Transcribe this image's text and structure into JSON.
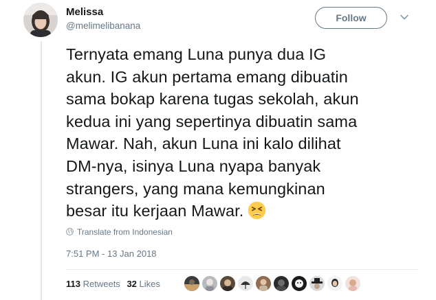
{
  "author": {
    "display_name": "Melissa",
    "handle": "@melimelibanana",
    "avatar_icon": "user-avatar"
  },
  "follow_label": "Follow",
  "tweet": {
    "lines": [
      "Ternyata emang Luna punya dua IG",
      "akun. IG akun pertama emang dibuatin",
      "sama bokap karena tugas sekolah, akun",
      "kedua ini yang sepertinya dibuatin sama",
      "Mawar. Nah, akun Luna ini kalo dilihat",
      "DM-nya, isinya Luna nyapa banyak",
      "strangers, yang mana kemungkinan",
      "besar itu kerjaan Mawar."
    ],
    "emoji": "tired-face-emoji"
  },
  "translate_label": "Translate from Indonesian",
  "timestamp": "7:51 PM - 13 Jan 2018",
  "stats": {
    "retweets_count": "113",
    "retweets_label": "Retweets",
    "likes_count": "32",
    "likes_label": "Likes"
  },
  "colors": {
    "text": "#14171a",
    "secondary": "#657786",
    "divider": "#e6ecf0",
    "emoji_face": "#ffcc4d"
  }
}
